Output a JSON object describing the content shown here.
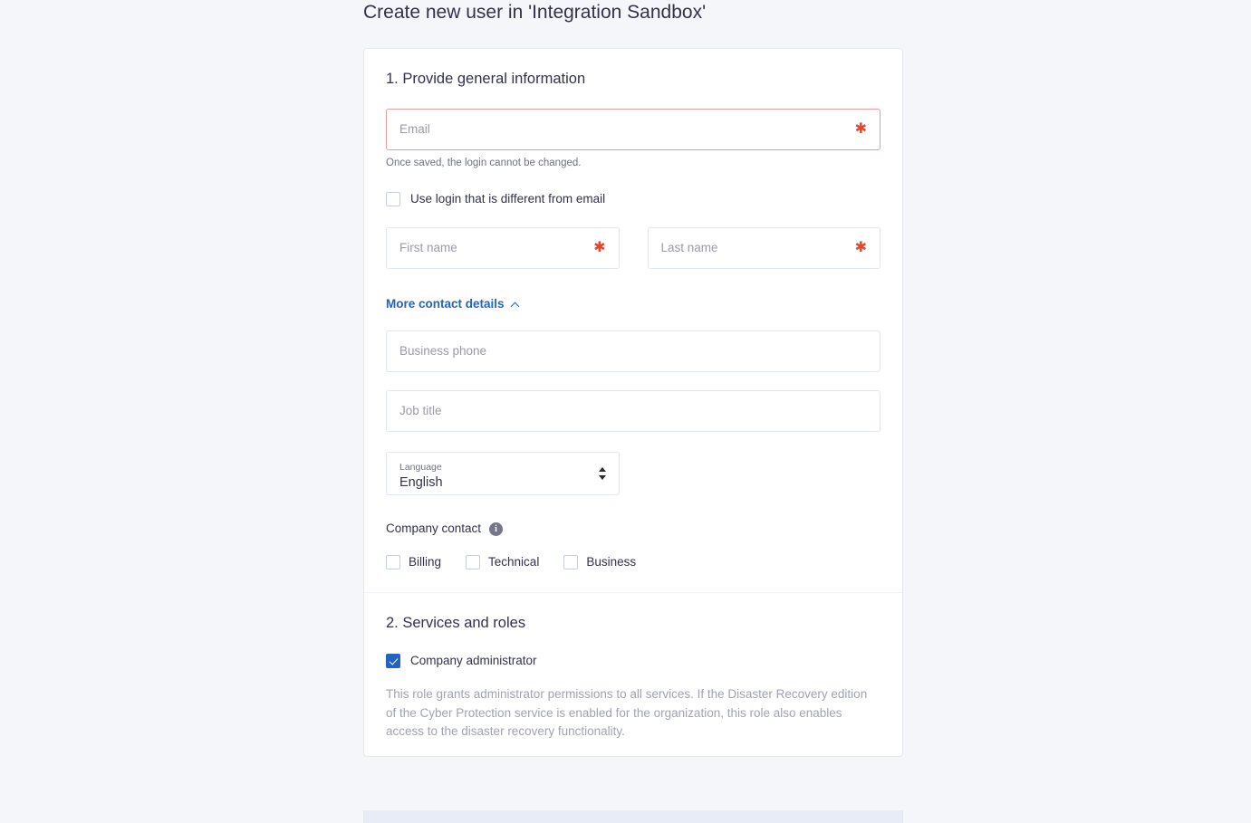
{
  "page": {
    "title": "Create new user in 'Integration Sandbox'",
    "background_color": "#f5f6fa"
  },
  "colors": {
    "accent": "#2264c4",
    "required": "#e8452c",
    "error_border": "#ef9a9a",
    "card_background": "#ffffff",
    "muted_text": "#a0a3b2"
  },
  "section_general": {
    "title": "1. Provide general information",
    "email": {
      "placeholder": "Email",
      "value": "",
      "required_marker": "✱",
      "state": "error"
    },
    "email_hint": "Once saved, the login cannot be changed.",
    "use_login_checkbox": {
      "label": "Use login that is different from email",
      "checked": false
    },
    "first_name": {
      "placeholder": "First name",
      "value": "",
      "required_marker": "✱"
    },
    "last_name": {
      "placeholder": "Last name",
      "value": "",
      "required_marker": "✱"
    },
    "more_contact_details": {
      "label": "More contact details",
      "expanded": true,
      "icon": "chevron-up-icon"
    },
    "business_phone": {
      "placeholder": "Business phone",
      "value": ""
    },
    "job_title": {
      "placeholder": "Job title",
      "value": ""
    },
    "language": {
      "label": "Language",
      "value": "English",
      "icon": "select-arrows-icon"
    },
    "company_contact": {
      "label": "Company contact",
      "info_icon": "info-icon",
      "info_glyph": "i",
      "options": [
        {
          "label": "Billing",
          "checked": false
        },
        {
          "label": "Technical",
          "checked": false
        },
        {
          "label": "Business",
          "checked": false
        }
      ]
    }
  },
  "section_services": {
    "title": "2. Services and roles",
    "company_administrator": {
      "label": "Company administrator",
      "checked": true
    },
    "role_description": "This role grants administrator permissions to all services. If the Disaster Recovery edition of the Cyber Protection service is enabled for the organization, this role also enables access to the disaster recovery functionality."
  }
}
